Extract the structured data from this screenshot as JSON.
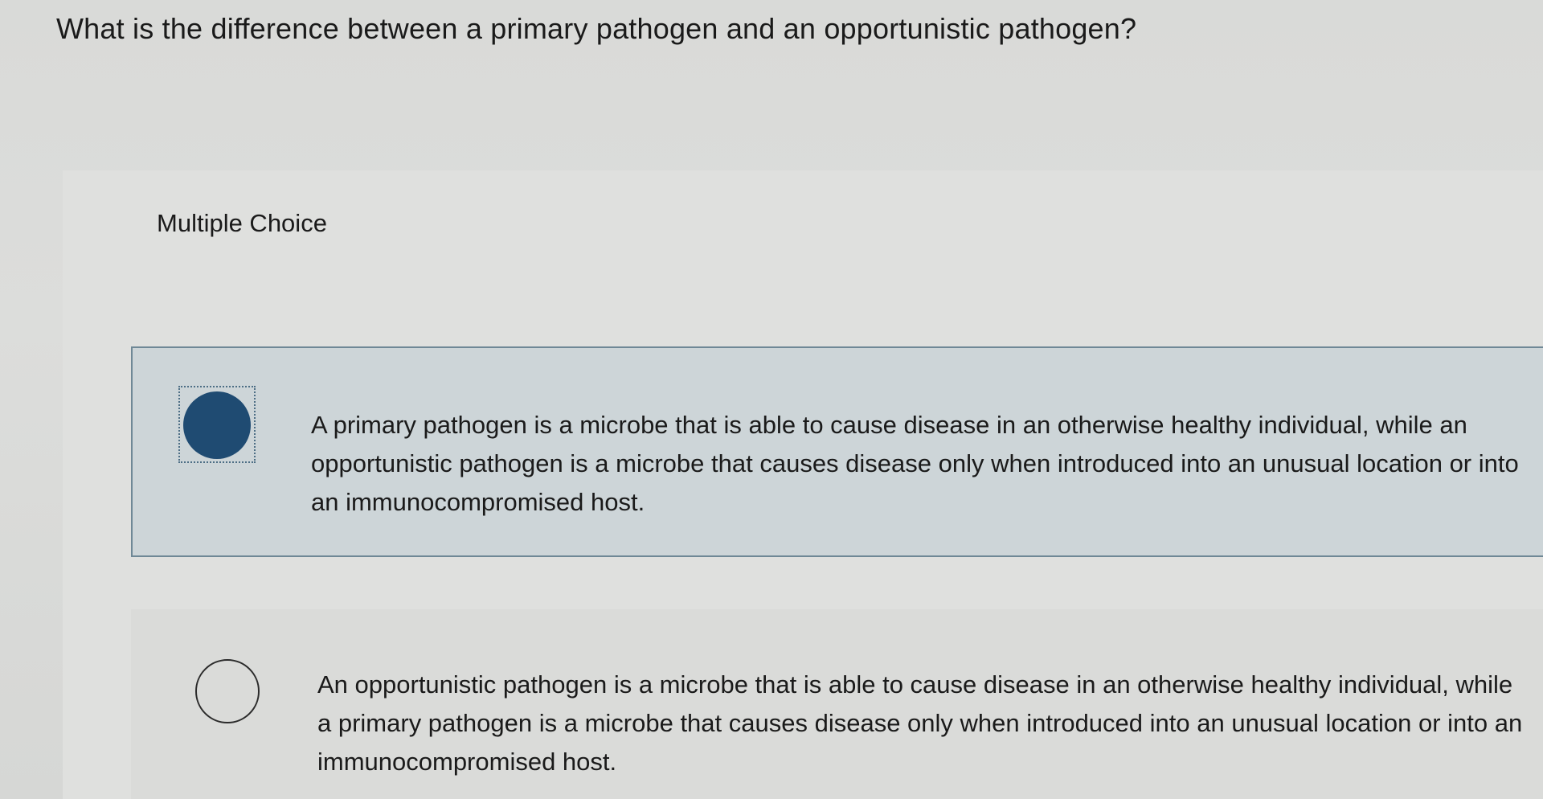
{
  "question": {
    "text": "What is the difference between a primary pathogen and an opportunistic pathogen?"
  },
  "section": {
    "label": "Multiple Choice"
  },
  "options": [
    {
      "text": "A primary pathogen is a microbe that is able to cause disease in an otherwise healthy individual, while an opportunistic pathogen is a microbe that causes disease only when introduced into an unusual location or into an immunocompromised host.",
      "selected": true
    },
    {
      "text": "An opportunistic pathogen is a microbe that is able to cause disease in an otherwise healthy individual, while a primary pathogen is a microbe that causes disease only when introduced into an unusual location or into an immunocompromised host.",
      "selected": false
    }
  ],
  "colors": {
    "selected_radio": "#1f4b72",
    "selected_background": "#cdd5d8",
    "selected_border": "#6f8896"
  }
}
